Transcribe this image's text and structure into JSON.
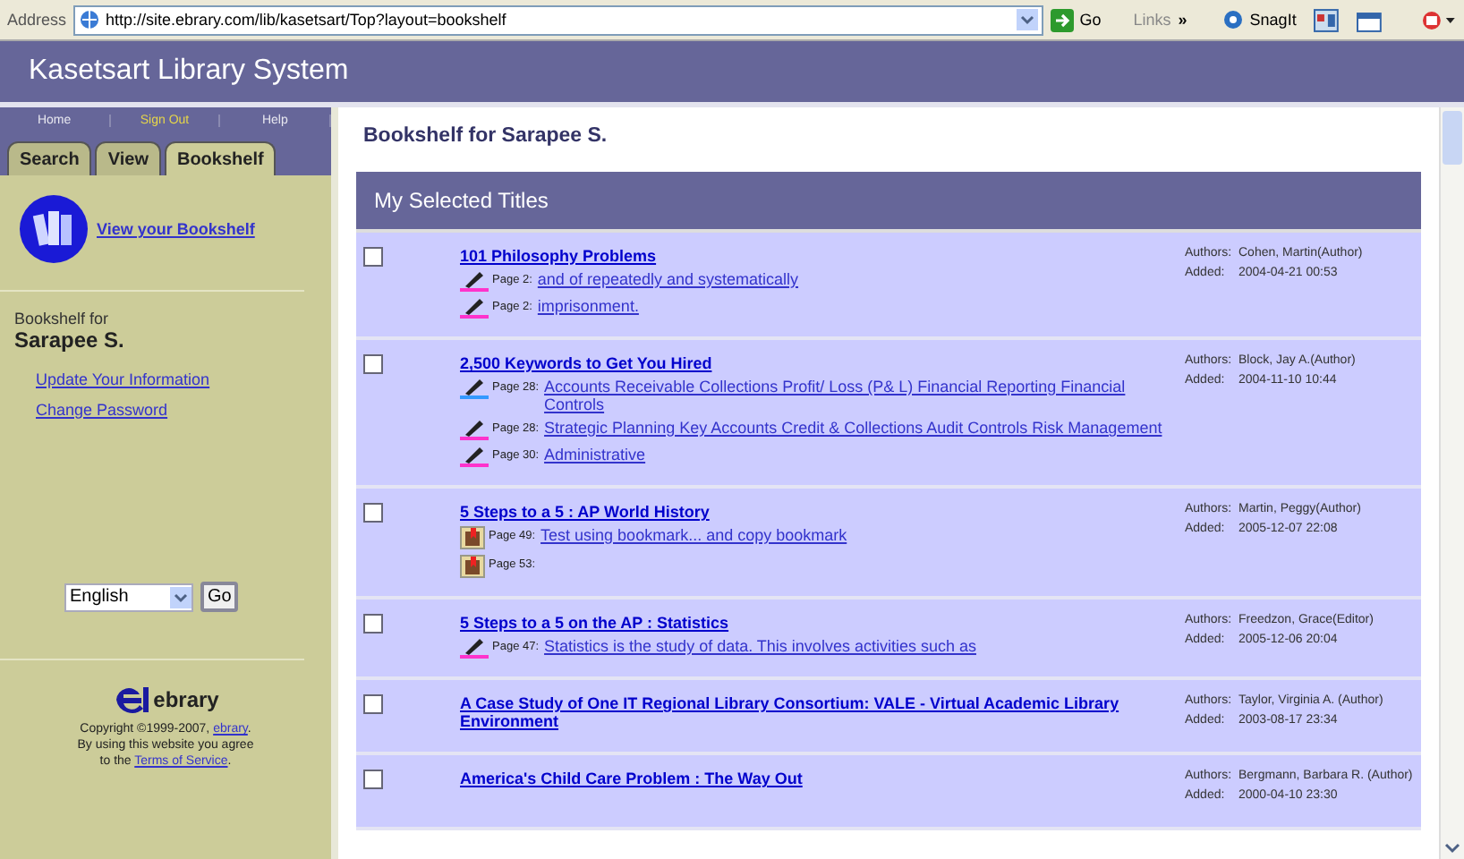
{
  "browser": {
    "address_label": "Address",
    "url": "http://site.ebrary.com/lib/kasetsart/Top?layout=bookshelf",
    "go": "Go",
    "links": "Links",
    "more": "»",
    "snagit": "SnagIt"
  },
  "header": {
    "title": "Kasetsart Library System"
  },
  "sidebar": {
    "nav": [
      {
        "label": "Home",
        "highlighted": false
      },
      {
        "label": "Sign Out",
        "highlighted": true
      },
      {
        "label": "Help",
        "highlighted": false
      }
    ],
    "tabs": [
      {
        "label": "Search",
        "selected": false
      },
      {
        "label": "View",
        "selected": false
      },
      {
        "label": "Bookshelf",
        "selected": true
      }
    ],
    "view_link": "View your Bookshelf",
    "owner_caption": "Bookshelf for",
    "owner_name": "Sarapee S.",
    "links": [
      "Update Your Information",
      "Change Password"
    ],
    "language": "English",
    "language_go": "Go",
    "logo_text": "ebrary",
    "copyright": "Copyright ©1999-2007, ",
    "copyright_link": "ebrary",
    "copyright_end": ".",
    "agree": "By using this website you agree",
    "agree2": "to the ",
    "terms": "Terms of Service",
    "terms_end": "."
  },
  "main": {
    "title": "Bookshelf for Sarapee S.",
    "section": "My Selected Titles",
    "rows": [
      {
        "checked": false,
        "title": "101 Philosophy Problems",
        "authors_label": "Authors:",
        "authors": "Cohen, Martin(Author)",
        "added_label": "Added:",
        "added": "2004-04-21 00:53",
        "notes": [
          {
            "kind": "highlight",
            "color": "#ff33cc",
            "page": "Page 2:",
            "text": "and of repeatedly and systematically"
          },
          {
            "kind": "highlight",
            "color": "#ff33cc",
            "page": "Page 2:",
            "text": "imprisonment."
          }
        ]
      },
      {
        "checked": false,
        "title": "2,500 Keywords to Get You Hired",
        "authors_label": "Authors:",
        "authors": "Block, Jay A.(Author)",
        "added_label": "Added:",
        "added": "2004-11-10 10:44",
        "notes": [
          {
            "kind": "highlight",
            "color": "#3399ff",
            "page": "Page 28:",
            "text": "Accounts Receivable Collections Profit/ Loss (P& L) Financial Reporting Financial Controls"
          },
          {
            "kind": "highlight",
            "color": "#ff33cc",
            "page": "Page 28:",
            "text": "Strategic Planning Key Accounts Credit & Collections Audit Controls Risk Management"
          },
          {
            "kind": "highlight",
            "color": "#ff33cc",
            "page": "Page 30:",
            "text": "Administrative"
          }
        ]
      },
      {
        "checked": false,
        "title": "5 Steps to a 5 : AP World History",
        "authors_label": "Authors:",
        "authors": "Martin, Peggy(Author)",
        "added_label": "Added:",
        "added": "2005-12-07 22:08",
        "notes": [
          {
            "kind": "bookmark",
            "page": "Page 49:",
            "text": "Test using bookmark... and copy bookmark"
          },
          {
            "kind": "bookmark",
            "page": "Page 53:"
          }
        ]
      },
      {
        "checked": false,
        "title": "5 Steps to a 5 on the AP : Statistics",
        "authors_label": "Authors:",
        "authors": "Freedzon, Grace(Editor)",
        "added_label": "Added:",
        "added": "2005-12-06 20:04",
        "notes": [
          {
            "kind": "highlight",
            "color": "#ff33cc",
            "page": "Page 47:",
            "text": "Statistics is the study of data. This involves activities such as"
          }
        ]
      },
      {
        "checked": false,
        "title": "A Case Study of One IT Regional Library Consortium: VALE - Virtual Academic Library Environment",
        "authors_label": "Authors:",
        "authors": "Taylor, Virginia A. (Author)",
        "added_label": "Added:",
        "added": "2003-08-17 23:34",
        "notes": []
      },
      {
        "checked": false,
        "title": "America's Child Care Problem : The Way Out",
        "authors_label": "Authors:",
        "authors": "Bergmann, Barbara R. (Author)",
        "added_label": "Added:",
        "added": "2000-04-10 23:30",
        "notes": []
      }
    ]
  }
}
